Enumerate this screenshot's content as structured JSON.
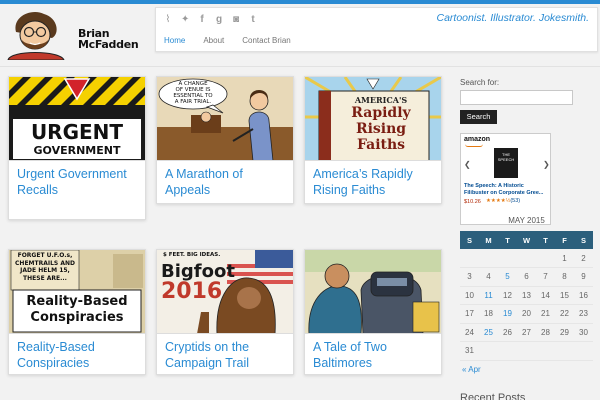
{
  "site": {
    "name_line1": "Brian",
    "name_line2": "McFadden",
    "tagline": "Cartoonist. Illustrator. Jokesmith.",
    "accent": "#2a8bd3"
  },
  "social_icons": [
    "rss-icon",
    "twitter-icon",
    "facebook-icon",
    "google-plus-icon",
    "instagram-icon",
    "tumblr-icon"
  ],
  "nav": [
    {
      "label": "Home",
      "active": true
    },
    {
      "label": "About",
      "active": false
    },
    {
      "label": "Contact Brian",
      "active": false
    }
  ],
  "posts": [
    {
      "title": "Urgent Government Recalls",
      "thumb_text": [
        "URGENT",
        "GOVERNMENT"
      ]
    },
    {
      "title": "A Marathon of Appeals",
      "thumb_text": [
        "A CHANGE",
        "OF VENUE IS",
        "ESSENTIAL TO",
        "A FAIR TRIAL."
      ]
    },
    {
      "title": "America’s Rapidly Rising Faiths",
      "thumb_text": [
        "AMERICA'S",
        "Rapidly",
        "Rising",
        "Faiths"
      ]
    },
    {
      "title": "Reality-Based Conspiracies",
      "thumb_text": [
        "FORGET U.F.O.s,",
        "CHEMTRAILS AND",
        "JADE HELM 15,",
        "THESE ARE...",
        "Reality-Based",
        "Conspiracies"
      ]
    },
    {
      "title": "Cryptids on the Campaign Trail",
      "thumb_text": [
        "$ FEET. BIG IDEAS.",
        "Bigfoot",
        "2016"
      ]
    },
    {
      "title": "A Tale of Two Baltimores",
      "thumb_text": []
    }
  ],
  "sidebar": {
    "search_label": "Search for:",
    "search_value": "",
    "search_button": "Search",
    "ad": {
      "brand": "amazon",
      "book_cover": "THE SPEECH",
      "title": "The Speech: A Historic Filibuster on Corporate Gree...",
      "price": "$10.26",
      "stars": "★★★★½",
      "reviews": "(53)"
    },
    "calendar": {
      "caption": "MAY 2015",
      "weekdays": [
        "S",
        "M",
        "T",
        "W",
        "T",
        "F",
        "S"
      ],
      "rows": [
        [
          "",
          "",
          "",
          "",
          "",
          "1",
          "2"
        ],
        [
          "3",
          "4",
          "5",
          "6",
          "7",
          "8",
          "9"
        ],
        [
          "10",
          "11",
          "12",
          "13",
          "14",
          "15",
          "16"
        ],
        [
          "17",
          "18",
          "19",
          "20",
          "21",
          "22",
          "23"
        ],
        [
          "24",
          "25",
          "26",
          "27",
          "28",
          "29",
          "30"
        ],
        [
          "31",
          "",
          "",
          "",
          "",
          "",
          ""
        ]
      ],
      "linked_days": [
        "5",
        "11",
        "19",
        "25"
      ],
      "prev_link": "« Apr"
    },
    "recent_heading": "Recent Posts"
  }
}
